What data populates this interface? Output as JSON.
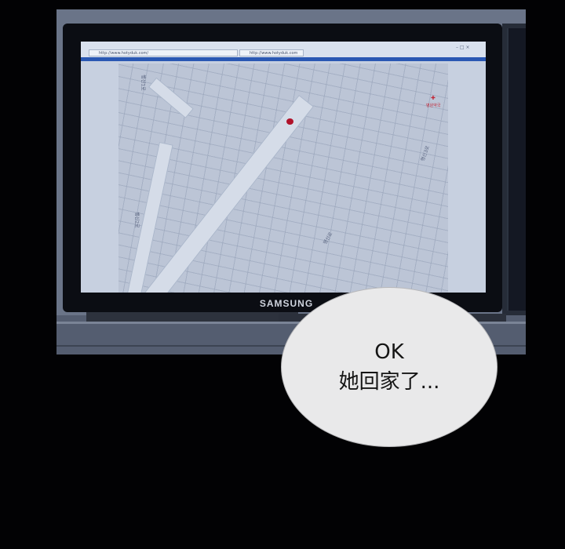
{
  "browser": {
    "url_tab_1": "http://www.hotyduk.com/",
    "url_tab_2": "http://www.hotyduk.com",
    "window_controls": "– □ ×"
  },
  "map": {
    "poi_icon": "place-marker-icon",
    "poi_label": "병원약국",
    "road_labels": [
      "행신1로",
      "행신2로",
      "행신3로",
      "행신로"
    ]
  },
  "monitor": {
    "brand": "SAMSUNG"
  },
  "bubble": {
    "line1": "OK",
    "line2": "她回家了..."
  },
  "colors": {
    "background": "#020204",
    "bubble_fill": "#e9e9ea",
    "pin": "#b0122a",
    "browser_strip": "#2a58b3"
  }
}
